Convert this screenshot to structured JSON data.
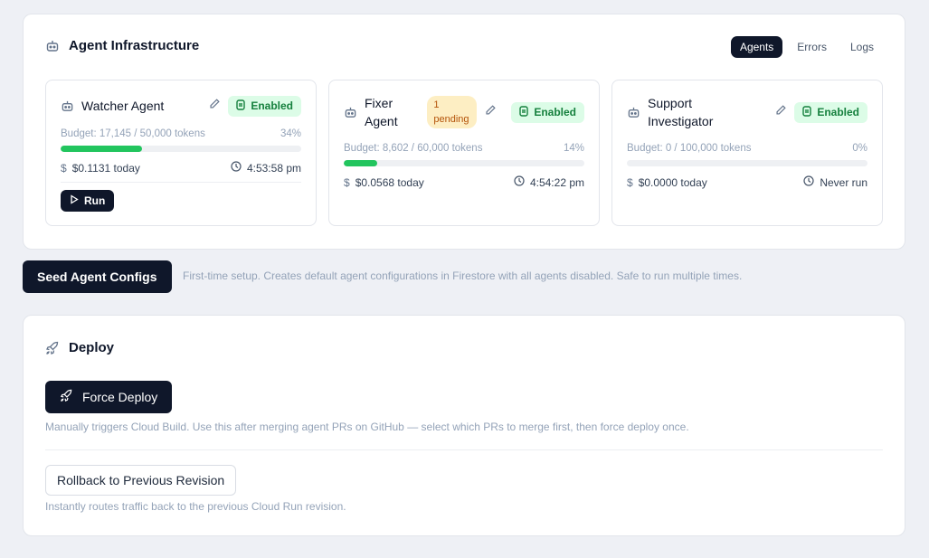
{
  "infra": {
    "title": "Agent Infrastructure",
    "tabs": [
      {
        "label": "Agents",
        "active": true
      },
      {
        "label": "Errors",
        "active": false
      },
      {
        "label": "Logs",
        "active": false
      }
    ]
  },
  "agents": [
    {
      "name": "Watcher Agent",
      "status": "Enabled",
      "budget_text": "Budget: 17,145 / 50,000 tokens",
      "percent_text": "34%",
      "percent": 34,
      "cost": "$0.1131 today",
      "last_run": "4:53:58 pm",
      "run_label": "Run"
    },
    {
      "name_line1": "Fixer",
      "name_line2": "Agent",
      "pending_line1": "1",
      "pending_line2": "pending",
      "status": "Enabled",
      "budget_text": "Budget: 8,602 / 60,000 tokens",
      "percent_text": "14%",
      "percent": 14,
      "cost": "$0.0568 today",
      "last_run": "4:54:22 pm"
    },
    {
      "name_line1": "Support",
      "name_line2": "Investigator",
      "status": "Enabled",
      "budget_text": "Budget: 0 / 100,000 tokens",
      "percent_text": "0%",
      "percent": 0,
      "cost": "$0.0000 today",
      "last_run": "Never run"
    }
  ],
  "seed": {
    "button_label": "Seed Agent Configs",
    "note": "First-time setup. Creates default agent configurations in Firestore with all agents disabled. Safe to run multiple times."
  },
  "deploy": {
    "title": "Deploy",
    "force_label": "Force Deploy",
    "force_note": "Manually triggers Cloud Build. Use this after merging agent PRs on GitHub — select which PRs to merge first, then force deploy once.",
    "rollback_label": "Rollback to Previous Revision",
    "rollback_note": "Instantly routes traffic back to the previous Cloud Run revision."
  },
  "colors": {
    "accent": "#0f172a",
    "success": "#22c55e",
    "pending_bg": "#fdeec3",
    "pending_text": "#b45309"
  },
  "icons": [
    "bot-icon",
    "pencil-icon",
    "toggle-icon",
    "dollar-icon",
    "clock-icon",
    "play-icon",
    "rocket-icon"
  ]
}
